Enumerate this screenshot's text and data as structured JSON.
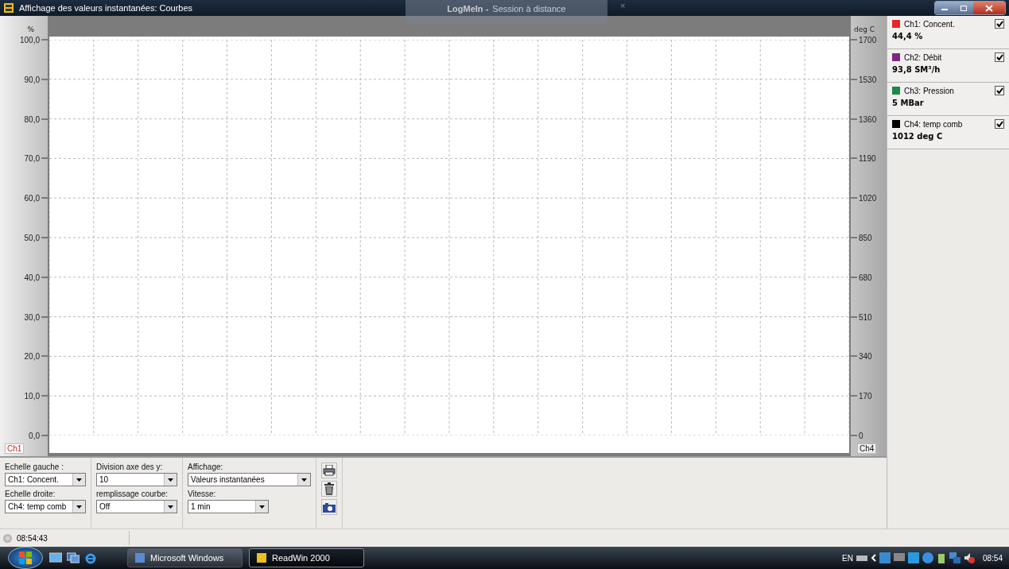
{
  "window": {
    "title": "Affichage des valeurs instantanées: Courbes"
  },
  "remote_tab": {
    "brand": "LogMeIn -",
    "label": "Session à distance",
    "close": "×"
  },
  "left_axis": {
    "unit": "%",
    "ticks": [
      "100,0",
      "90,0",
      "80,0",
      "70,0",
      "60,0",
      "50,0",
      "40,0",
      "30,0",
      "20,0",
      "10,0",
      "0,0"
    ],
    "channel": "Ch1"
  },
  "right_axis": {
    "unit": "deg C",
    "ticks": [
      "1700",
      "1530",
      "1360",
      "1190",
      "1020",
      "850",
      "680",
      "510",
      "340",
      "170",
      "0"
    ],
    "channel": "Ch4"
  },
  "channels": [
    {
      "name": "Ch1:  Concent.",
      "value": "44,4 %",
      "color": "#e8262a",
      "checked": true
    },
    {
      "name": "Ch2:  Débit",
      "value": "93,8 SM³/h",
      "color": "#7c2a80",
      "checked": true
    },
    {
      "name": "Ch3:  Pression",
      "value": "5 MBar",
      "color": "#1b8a45",
      "checked": true
    },
    {
      "name": "Ch4:  temp comb",
      "value": "1012 deg C",
      "color": "#000000",
      "checked": true
    }
  ],
  "controls": [
    {
      "label": "Echelle gauche :",
      "value": "Ch1: Concent."
    },
    {
      "label": "Echelle droite:",
      "value": "Ch4: temp comb"
    },
    {
      "label": "Division axe des y:",
      "value": "10"
    },
    {
      "label": "remplissage courbe:",
      "value": "Off"
    },
    {
      "label": "Affichage:",
      "value": "Valeurs instantanées"
    },
    {
      "label": "Vitesse:",
      "value": "1 min"
    }
  ],
  "status_bar": {
    "time": "08:54:43"
  },
  "taskbar": {
    "buttons": [
      {
        "label": "Microsoft Windows",
        "selected": false
      },
      {
        "label": "ReadWin 2000",
        "selected": true
      }
    ],
    "language": "EN",
    "clock": "08:54"
  }
}
